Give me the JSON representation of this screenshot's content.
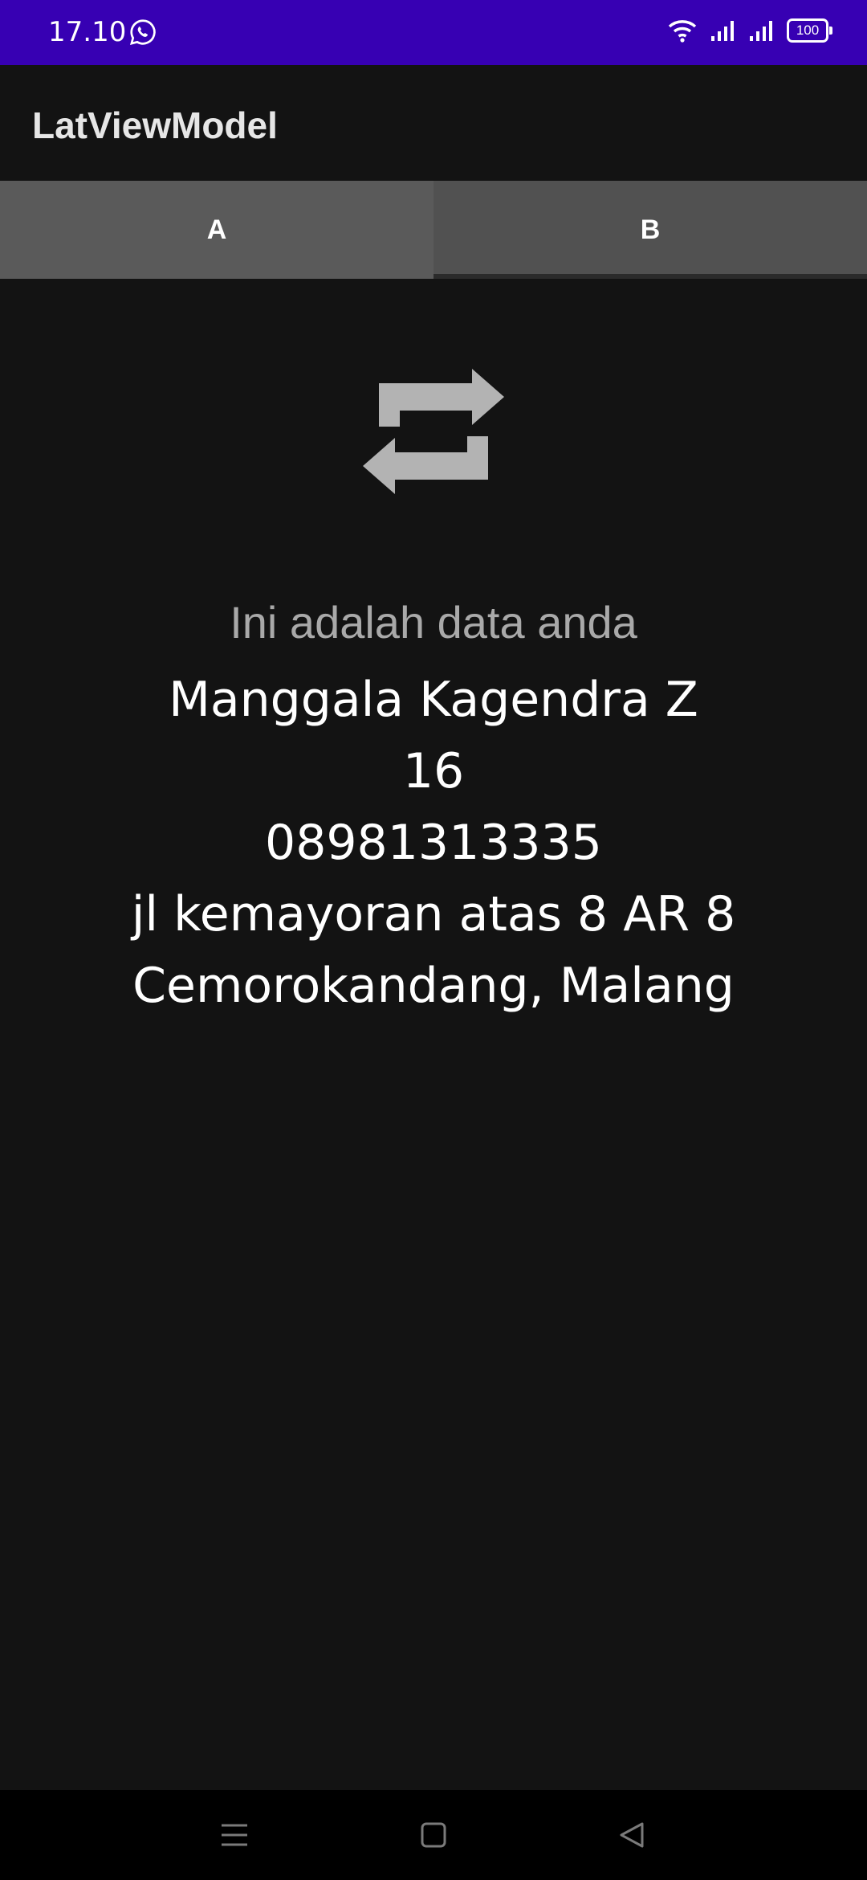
{
  "status_bar": {
    "time": "17.10",
    "battery": "100",
    "whatsapp_icon": "whatsapp-icon",
    "wifi_icon": "wifi-icon",
    "signal_icon": "signal-icon"
  },
  "app_bar": {
    "title": "LatViewModel"
  },
  "tabs": [
    {
      "label": "A"
    },
    {
      "label": "B"
    }
  ],
  "content": {
    "icon": "swap-arrows-icon",
    "subtitle": "Ini adalah data anda",
    "name": "Manggala Kagendra Z",
    "age": "16",
    "phone": "08981313335",
    "address_line1": "jl kemayoran atas 8 AR 8",
    "address_line2": "Cemorokandang, Malang"
  },
  "nav_bar": {
    "menu_icon": "menu-icon",
    "home_icon": "home-square-icon",
    "back_icon": "back-triangle-icon"
  },
  "colors": {
    "status_bar": "#3700b3",
    "background": "#131313",
    "tab_background": "#5a5a5a"
  }
}
